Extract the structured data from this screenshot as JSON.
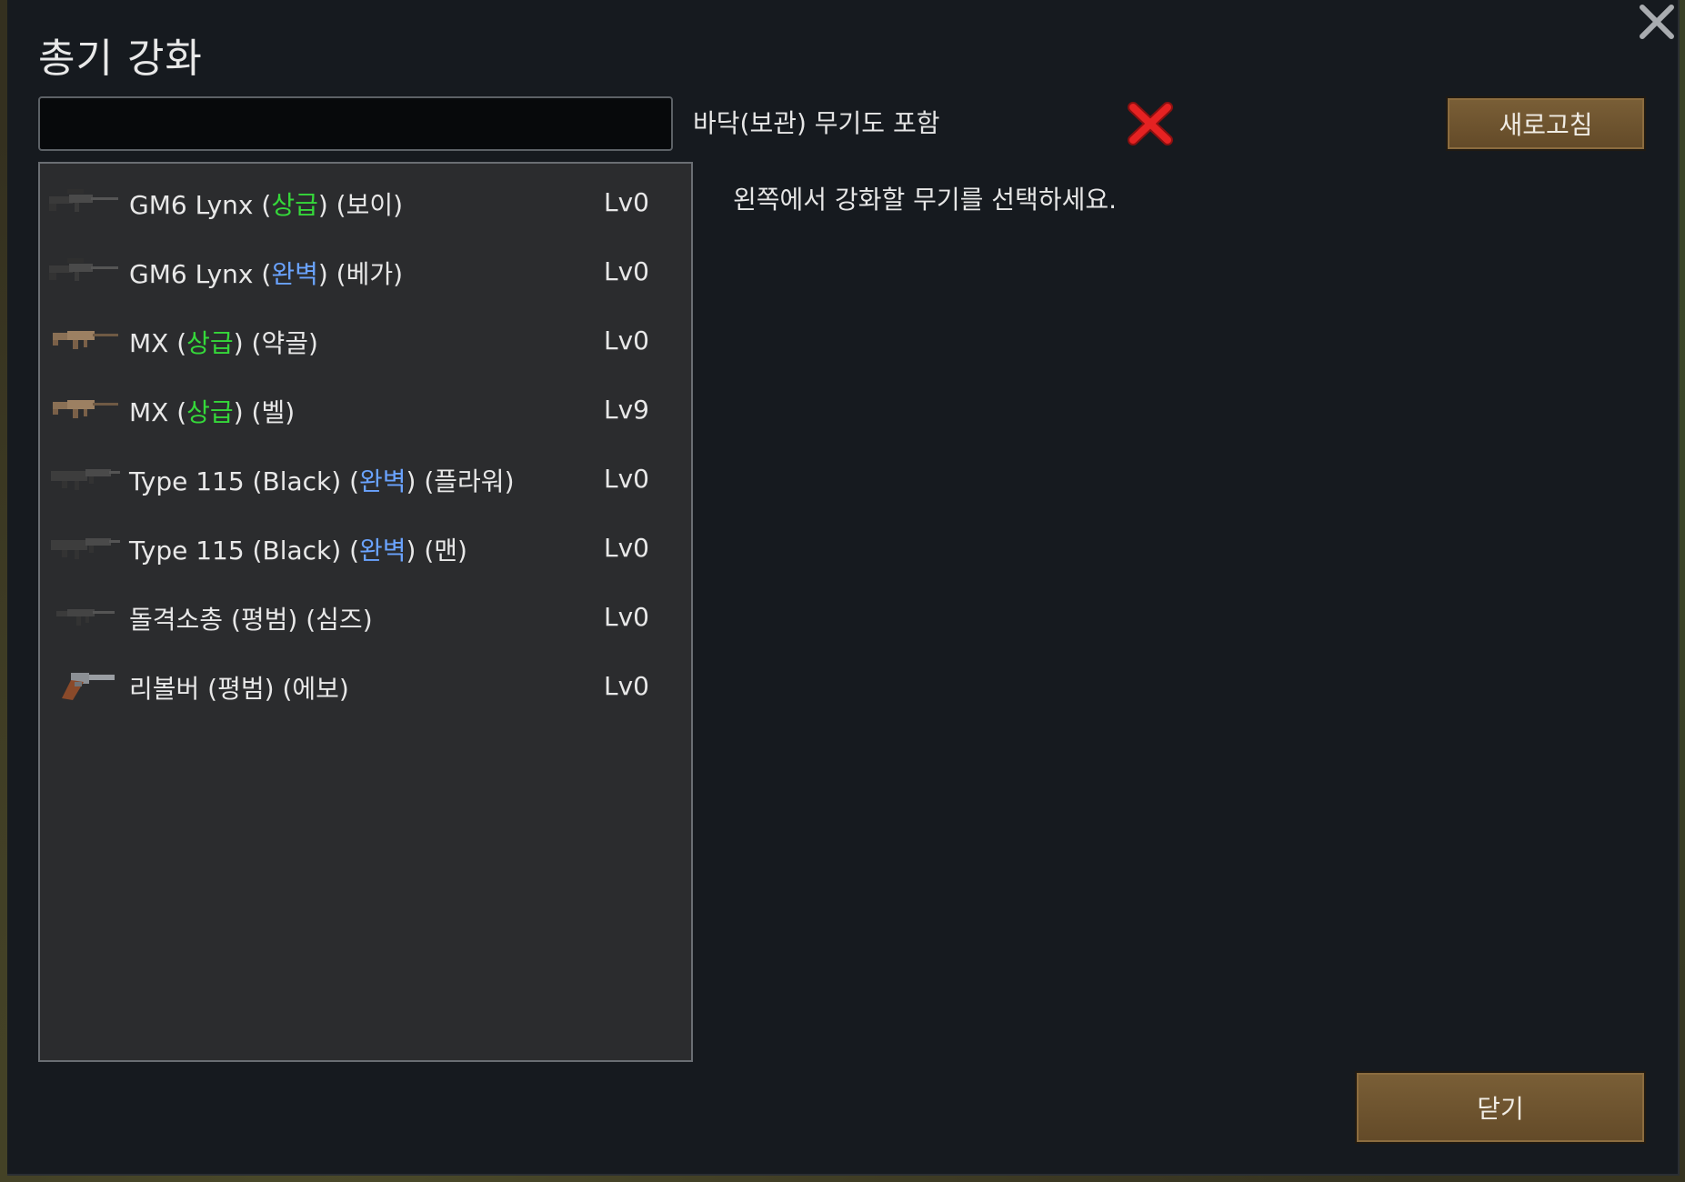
{
  "dialog": {
    "title": "총기 강화",
    "search": {
      "value": "",
      "placeholder": ""
    },
    "include_floor_label": "바닥(보관) 무기도 포함",
    "include_floor_checked": false,
    "refresh_label": "새로고침",
    "hint": "왼쪽에서 강화할 무기를 선택하세요.",
    "close_label": "닫기"
  },
  "weapons": [
    {
      "name": "GM6 Lynx",
      "quality": "상급",
      "quality_color": "#35d83a",
      "owner": "보이",
      "level": "Lv0",
      "icon": "sniper-rifle-icon"
    },
    {
      "name": "GM6 Lynx",
      "quality": "완벽",
      "quality_color": "#6aa3ff",
      "owner": "베가",
      "level": "Lv0",
      "icon": "sniper-rifle-icon"
    },
    {
      "name": "MX",
      "quality": "상급",
      "quality_color": "#35d83a",
      "owner": "약골",
      "level": "Lv0",
      "icon": "assault-rifle-icon"
    },
    {
      "name": "MX",
      "quality": "상급",
      "quality_color": "#35d83a",
      "owner": "벨",
      "level": "Lv9",
      "icon": "assault-rifle-icon"
    },
    {
      "name": "Type 115 (Black)",
      "quality": "완벽",
      "quality_color": "#6aa3ff",
      "owner": "플라워",
      "level": "Lv0",
      "icon": "bullpup-rifle-icon"
    },
    {
      "name": "Type 115 (Black)",
      "quality": "완벽",
      "quality_color": "#6aa3ff",
      "owner": "맨",
      "level": "Lv0",
      "icon": "bullpup-rifle-icon"
    },
    {
      "name": "돌격소총",
      "quality": "평범",
      "quality_color": "#e8e8e8",
      "owner": "심즈",
      "level": "Lv0",
      "icon": "assault-rifle-small-icon"
    },
    {
      "name": "리볼버",
      "quality": "평범",
      "quality_color": "#e8e8e8",
      "owner": "에보",
      "level": "Lv0",
      "icon": "revolver-icon"
    }
  ],
  "colors": {
    "dialog_bg": "#161a1f",
    "list_bg": "#2b2c2e",
    "button_bg": "#6e5430",
    "toggle_off": "#e02020",
    "quality_good": "#35d83a",
    "quality_excellent": "#6aa3ff"
  }
}
